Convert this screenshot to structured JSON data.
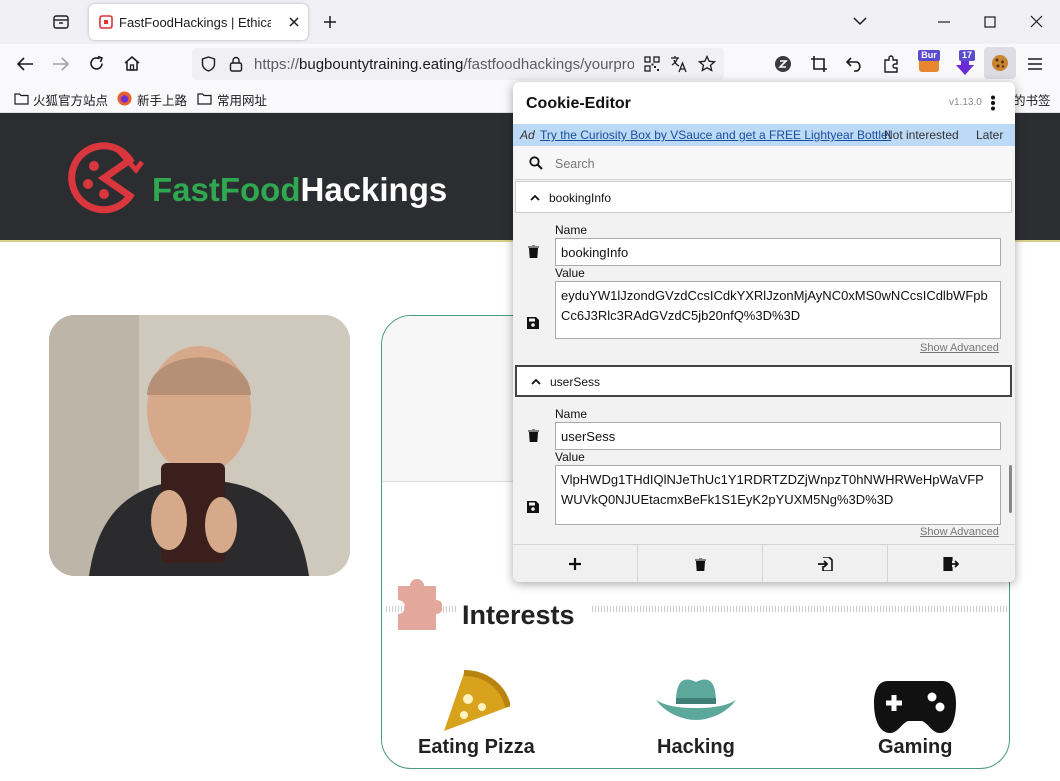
{
  "browser": {
    "tab_title": "FastFoodHackings | Ethical H",
    "url_scheme": "https://",
    "url_host": "bugbountytraining.eating",
    "url_path": "/fastfoodhackings/yourpro",
    "extension_badge_1": "Bur",
    "extension_badge_2": "17",
    "bookmarks": [
      "火狐官方站点",
      "新手上路",
      "常用网址"
    ],
    "bookmarks_right": "的书签"
  },
  "site": {
    "brand_part1": "FastFood",
    "brand_part2": "Hackings",
    "interests_title": "Interests",
    "interests": [
      "Eating Pizza",
      "Hacking",
      "Gaming"
    ],
    "colors": {
      "header_bg": "#2b2d30",
      "brand_green": "#2fa84f",
      "card_border": "#4a9a86"
    }
  },
  "cookie_editor": {
    "title": "Cookie-Editor",
    "version": "v1.13.0",
    "ad_prefix": "Ad",
    "ad_text": "Try the Curiosity Box by VSauce and get a FREE Lightyear Bottle!",
    "ad_dismiss": "Not interested",
    "ad_later": "Later",
    "search_placeholder": "Search",
    "name_label": "Name",
    "value_label": "Value",
    "show_advanced": "Show Advanced",
    "cookies": [
      {
        "name": "bookingInfo",
        "value": "eyduYW1lJzondGVzdCcsICdkYXRlJzonMjAyNC0xMS0wNCcsICdlbWFpbCc6J3Rlc3RAdGVzdC5jb20nfQ%3D%3D"
      },
      {
        "name": "userSess",
        "value": "VlpHWDg1THdIQlNJeThUc1Y1RDRTZDZjWnpzT0hNWHRWeHpWaVFPWUVkQ0NJUEtacmxBeFk1S1EyK2pYUXM5Ng%3D%3D"
      }
    ]
  }
}
